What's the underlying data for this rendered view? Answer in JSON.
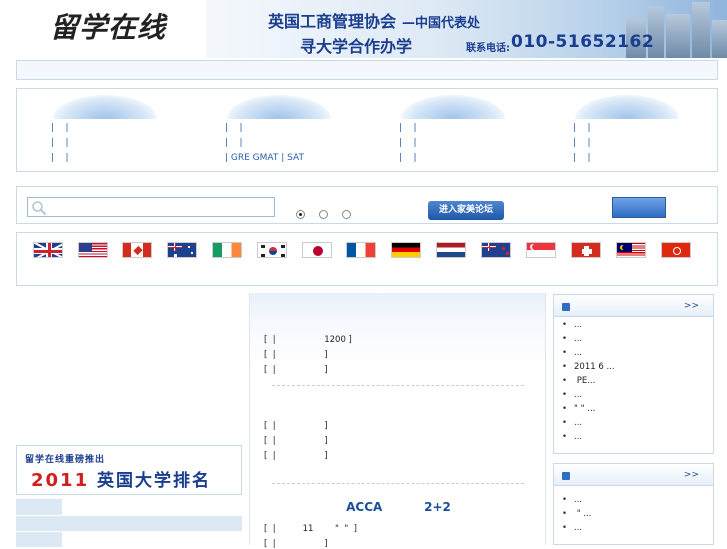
{
  "header": {
    "logo": "留学在线",
    "banner_line1": "英国工商管理协会",
    "banner_sub": "—中国代表处",
    "banner_line2": "寻大学合作办学",
    "contact_label": "联系电话:",
    "phone": "010-51652162"
  },
  "breadcrumb": "",
  "nav": {
    "columns": [
      {
        "title": "",
        "rows": [
          "|    |",
          "|    |",
          "|    |"
        ]
      },
      {
        "title": "",
        "rows": [
          "|    |",
          "|    |",
          "| GRE GMAT | SAT"
        ]
      },
      {
        "title": "",
        "rows": [
          "|    |",
          "|    |",
          "|    |"
        ]
      },
      {
        "title": "",
        "rows": [
          "|    |",
          "|    |",
          "|    |"
        ]
      }
    ]
  },
  "search": {
    "placeholder": "",
    "forum_button": "进入家美论坛",
    "search_button": ""
  },
  "flags": [
    {
      "name": "uk",
      "label": ""
    },
    {
      "name": "us",
      "label": ""
    },
    {
      "name": "canada",
      "label": ""
    },
    {
      "name": "australia",
      "label": ""
    },
    {
      "name": "ireland",
      "label": ""
    },
    {
      "name": "korea",
      "label": ""
    },
    {
      "name": "japan",
      "label": ""
    },
    {
      "name": "france",
      "label": ""
    },
    {
      "name": "germany",
      "label": ""
    },
    {
      "name": "netherlands",
      "label": ""
    },
    {
      "name": "new-zealand",
      "label": ""
    },
    {
      "name": "singapore",
      "label": ""
    },
    {
      "name": "switzerland",
      "label": ""
    },
    {
      "name": "malaysia",
      "label": ""
    },
    {
      "name": "hong-kong",
      "label": ""
    }
  ],
  "rank": {
    "line1": "留学在线重磅推出",
    "year": "2011",
    "line2": "英国大学排名"
  },
  "center": {
    "sections": [
      {
        "title": "",
        "items": [
          "[  |                  1200 ]",
          "[  |                  ]",
          "[  |                  ]"
        ]
      },
      {
        "title": "",
        "items": [
          "[  |                  ]",
          "[  |                  ]",
          "[  |                  ]"
        ]
      },
      {
        "title": "ACCA          2+2",
        "items": [
          "[  |          11        \"  \"  ]",
          "[  |                  ]"
        ]
      }
    ]
  },
  "right": {
    "panel1": {
      "title": "",
      "more": ">>",
      "items": [
        "...",
        "...",
        "...",
        "2011 6        ...",
        "              PE...",
        "...",
        "\"  \"     ...",
        "...",
        "..."
      ]
    },
    "panel2": {
      "title": "",
      "more": ">>",
      "items": [
        "...",
        "   \"      ...",
        "..."
      ]
    }
  }
}
